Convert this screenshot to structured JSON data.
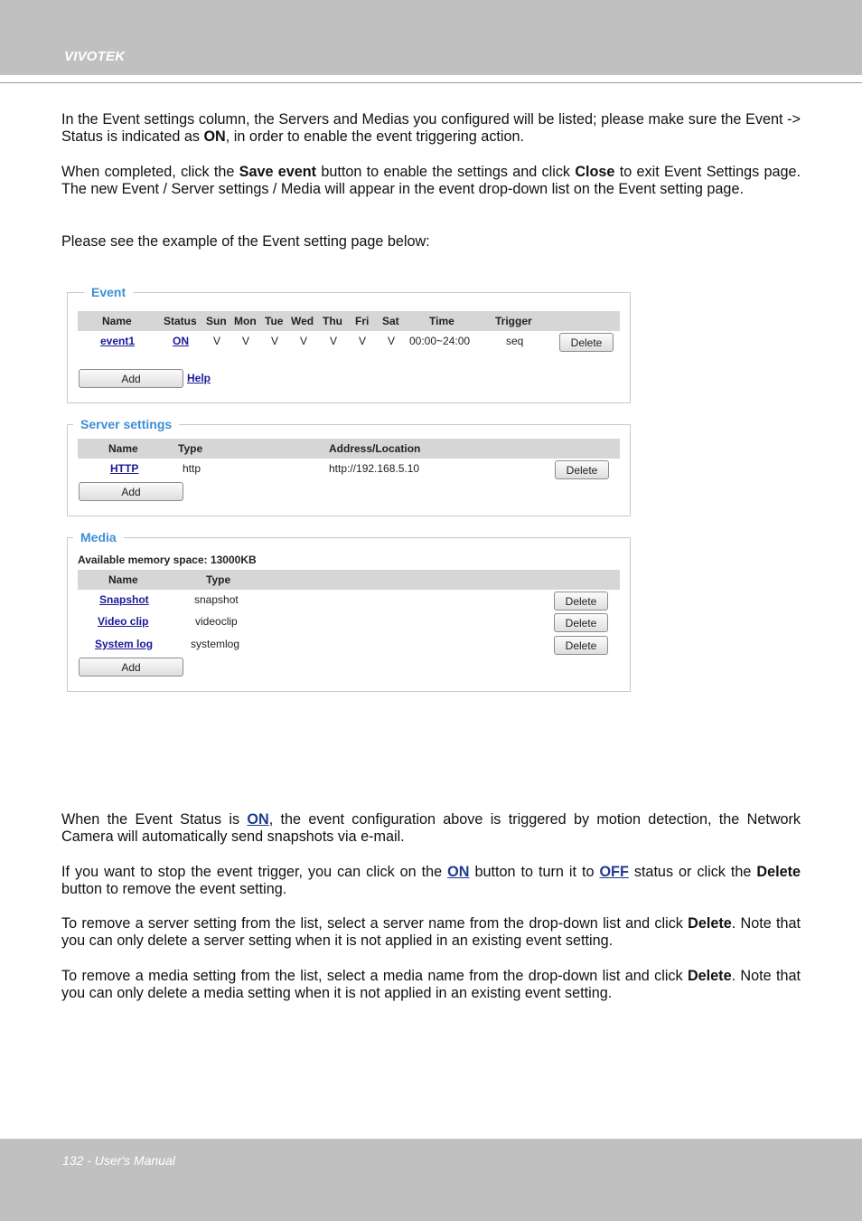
{
  "header": {
    "brand": "VIVOTEK"
  },
  "intro": {
    "p1": {
      "a": "In the Event settings column, the Servers and Medias you configured will be listed; please make sure the Event -> Status is indicated as ",
      "b": "ON",
      "c": ", in order to enable the event triggering action."
    },
    "p2": {
      "a": "When completed, click the ",
      "b": "Save event",
      "c": " button to enable the settings and click ",
      "d": "Close",
      "e": " to exit Event Settings page. The new Event / Server settings / Media will appear in the event drop-down list on the Event setting page."
    },
    "p3": "Please see the example of the Event setting page below:"
  },
  "event_panel": {
    "legend": "Event",
    "columns": [
      "Name",
      "Status",
      "Sun",
      "Mon",
      "Tue",
      "Wed",
      "Thu",
      "Fri",
      "Sat",
      "Time",
      "Trigger"
    ],
    "row": {
      "name": "event1",
      "status": "ON",
      "days": [
        "V",
        "V",
        "V",
        "V",
        "V",
        "V",
        "V"
      ],
      "time": "00:00~24:00",
      "trigger": "seq",
      "delete": "Delete"
    },
    "add": "Add",
    "help": "Help"
  },
  "server_panel": {
    "legend": "Server settings",
    "columns": [
      "Name",
      "Type",
      "Address/Location"
    ],
    "row": {
      "name": "HTTP",
      "type": "http",
      "address": "http://192.168.5.10",
      "delete": "Delete"
    },
    "add": "Add"
  },
  "media_panel": {
    "legend": "Media",
    "memory": "Available memory space: 13000KB",
    "columns": [
      "Name",
      "Type"
    ],
    "rows": [
      {
        "name": "Snapshot",
        "type": "snapshot",
        "delete": "Delete"
      },
      {
        "name": "Video clip",
        "type": "videoclip",
        "delete": "Delete"
      },
      {
        "name": "System log",
        "type": "systemlog",
        "delete": "Delete"
      }
    ],
    "add": "Add"
  },
  "notes": {
    "p4": {
      "a": "When the Event Status is ",
      "b": "ON",
      "c": ", the event configuration above is triggered by motion detection, the Network Camera will  automatically send snapshots via e-mail."
    },
    "p5": {
      "a": "If you want to stop the event trigger, you can click on the ",
      "b": "ON",
      "c": " button to turn it to ",
      "d": "OFF",
      "e": " status or click the ",
      "f": "Delete",
      "g": " button to remove the event setting."
    },
    "p6": {
      "a": "To remove a server setting from the list, select a server name from the drop-down list and click ",
      "b": "Delete",
      "c": ". Note that you can only delete a server setting when it is not applied in an existing event setting."
    },
    "p7": {
      "a": "To remove a media setting from the list, select a media name from the drop-down list and click ",
      "b": "Delete",
      "c": ". Note that you can only delete a media setting when it is not applied in an existing event setting."
    }
  },
  "footer": {
    "text": "132 - User's Manual"
  }
}
